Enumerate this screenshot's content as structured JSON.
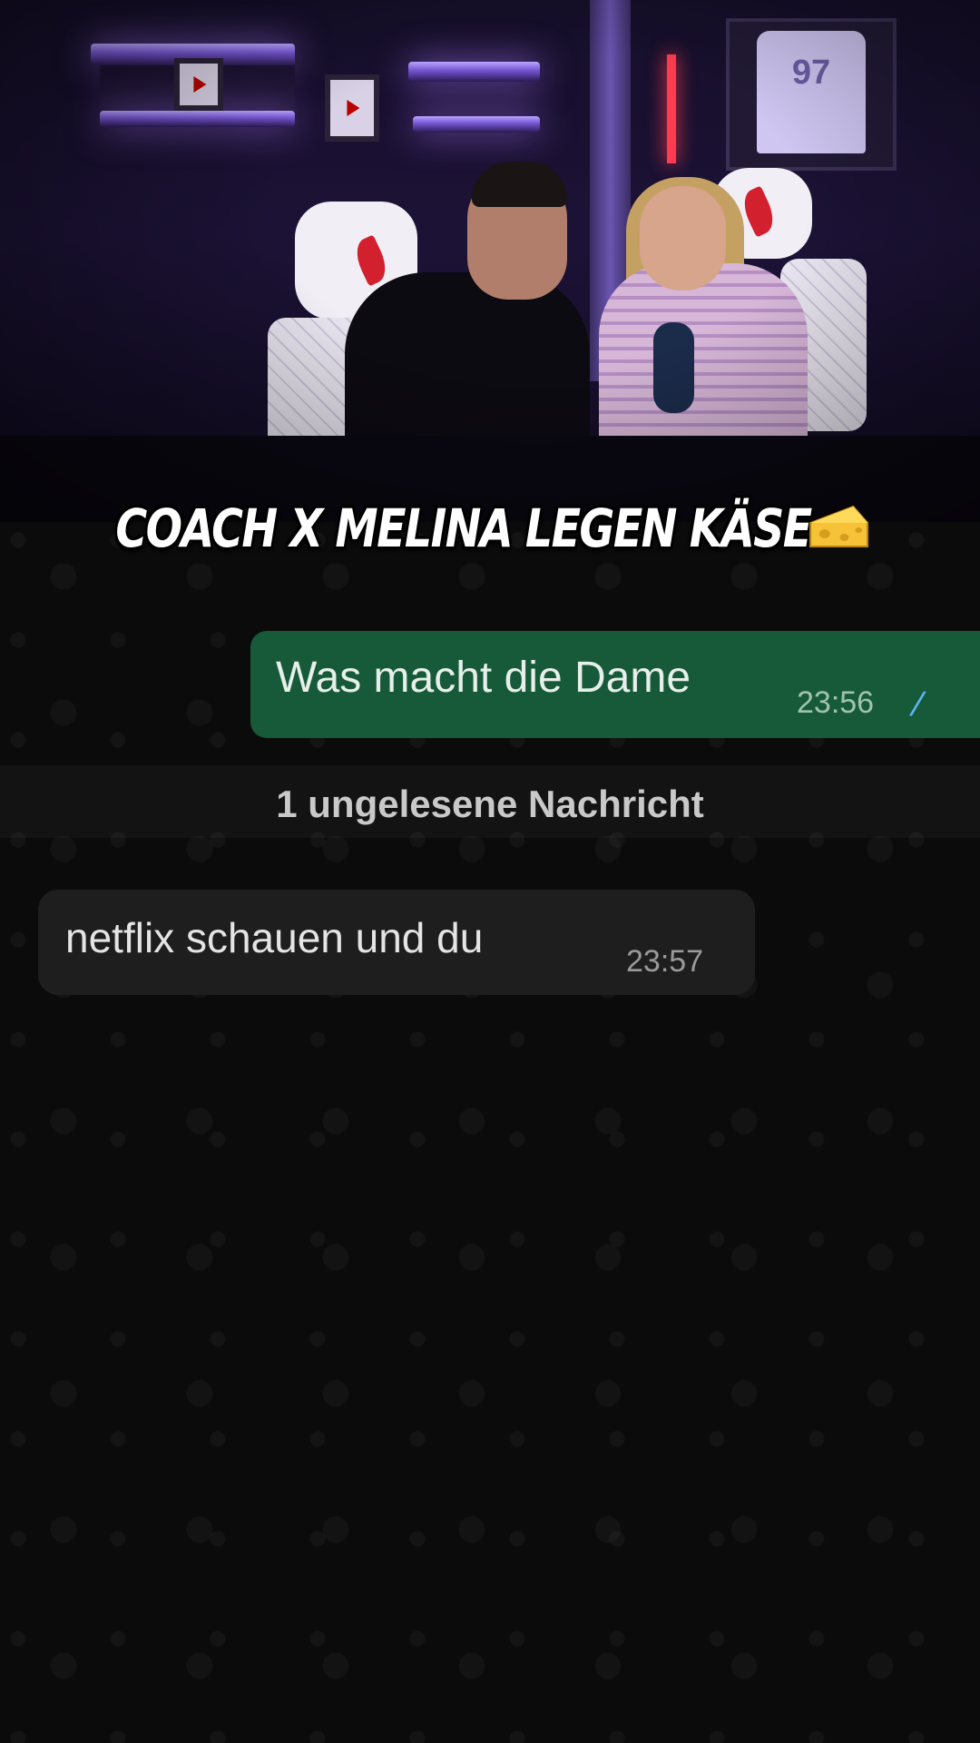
{
  "video": {
    "jersey_number": "97"
  },
  "caption": {
    "text": "COACH X MELINA LEGEN KÄSE",
    "emoji_icon": "cheese-wedge-emoji"
  },
  "chat": {
    "messages": [
      {
        "direction": "outgoing",
        "text": "Was macht die Dame",
        "time": "23:56",
        "status": "read"
      },
      {
        "direction": "incoming",
        "text": "netflix schauen und du",
        "time": "23:57"
      }
    ],
    "unread_divider": "1 ungelesene Nachricht",
    "colors": {
      "outgoing_bubble": "#175a3a",
      "incoming_bubble": "#1e1e1e",
      "read_ticks": "#5fb3f0"
    }
  }
}
